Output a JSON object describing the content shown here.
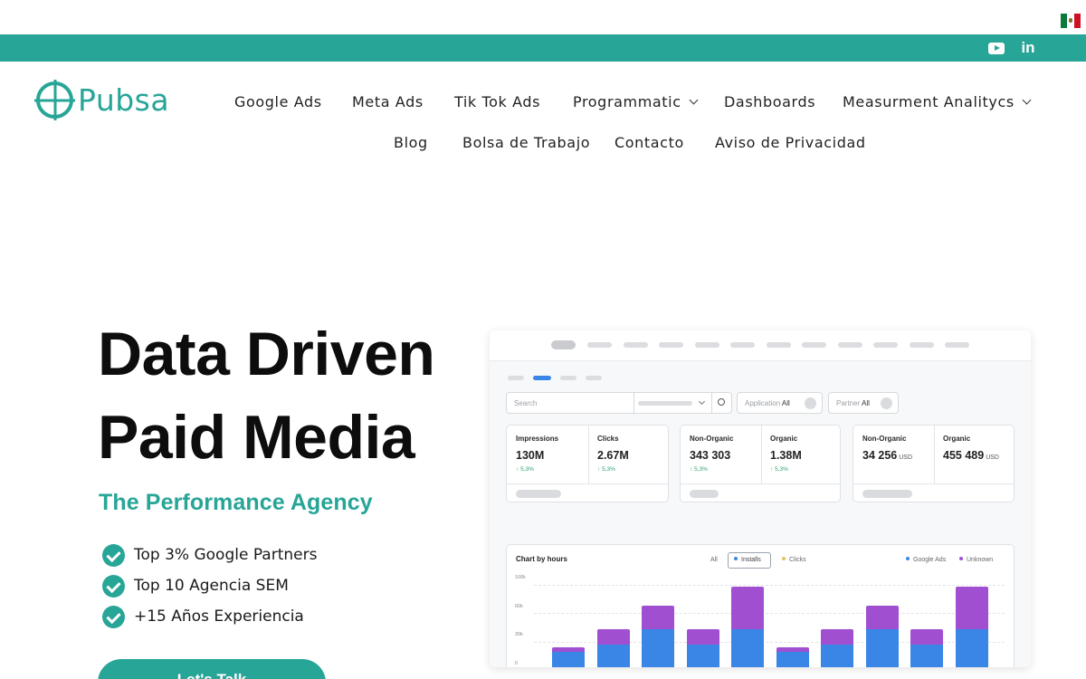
{
  "header": {
    "country_flag_icon": "mexico-flag-icon",
    "teal_color": "#27a597",
    "social_icons": [
      "youtube-icon",
      "linkedin-icon"
    ],
    "linkedin_label": "in"
  },
  "logo": {
    "text": "Pubsa",
    "icon": "crosshair-icon"
  },
  "nav": {
    "items": [
      {
        "label": "Google Ads"
      },
      {
        "label": "Meta Ads"
      },
      {
        "label": "Tik Tok Ads"
      },
      {
        "label": "Programmatic"
      },
      {
        "label": "Dashboards"
      },
      {
        "label": "Measurment Analitycs"
      },
      {
        "label": "Blog"
      },
      {
        "label": "Bolsa de Trabajo"
      },
      {
        "label": "Contacto"
      },
      {
        "label": "Aviso de Privacidad"
      }
    ]
  },
  "hero": {
    "title_line1": "Data Driven",
    "title_line2": "Paid Media",
    "subtitle": "The Performance Agency",
    "bullets": [
      {
        "text": "Top 3% Google Partners"
      },
      {
        "text": "Top 10 Agencia SEM"
      },
      {
        "text": "+15 Años Experiencia"
      }
    ],
    "cta_label": "Let's Talk"
  },
  "dashboard": {
    "search_placeholder": "Search",
    "application_label": "Application",
    "application_value": "All",
    "partner_label": "Partner",
    "partner_value": "All",
    "cards": [
      {
        "metrics": [
          {
            "label": "Impressions",
            "value": "130M",
            "unit": "",
            "change": "5,3%"
          },
          {
            "label": "Clicks",
            "value": "2.67M",
            "unit": "",
            "change": "5,3%"
          }
        ]
      },
      {
        "metrics": [
          {
            "label": "Non-Organic",
            "value": "343 303",
            "unit": "",
            "change": "5,3%"
          },
          {
            "label": "Organic",
            "value": "1.38M",
            "unit": "",
            "change": "5,3%"
          }
        ]
      },
      {
        "metrics": [
          {
            "label": "Non-Organic",
            "value": "34 256",
            "unit": "USD",
            "change": ""
          },
          {
            "label": "Organic",
            "value": "455 489",
            "unit": "USD",
            "change": ""
          }
        ]
      }
    ],
    "chart": {
      "title": "Chart by hours",
      "filter_all": "All",
      "filter_installs": "Installs",
      "filter_clicks": "Clicks",
      "legend_google": "Google Ads",
      "legend_unknown": "Unknown",
      "y_ticks": [
        "100k",
        "60k",
        "30k",
        "0"
      ],
      "colors": {
        "google": "#3a86e6",
        "unknown": "#a04fd1",
        "clicks_dot": "#e3c25a"
      }
    }
  },
  "chart_data": {
    "type": "bar",
    "title": "Chart by hours",
    "stacked": true,
    "categories": [
      "",
      "",
      "",
      "",
      "",
      "",
      "",
      "",
      "",
      ""
    ],
    "ylim": [
      0,
      100000
    ],
    "y_ticks": [
      "100k",
      "60k",
      "30k",
      "0"
    ],
    "series": [
      {
        "name": "Google Ads",
        "color": "#3a86e6",
        "values": [
          22000,
          30000,
          46000,
          30000,
          46000,
          22000,
          30000,
          46000,
          30000,
          46000
        ]
      },
      {
        "name": "Unknown",
        "color": "#a04fd1",
        "values": [
          5000,
          16000,
          25000,
          16000,
          45000,
          5000,
          16000,
          25000,
          16000,
          45000
        ]
      }
    ]
  }
}
